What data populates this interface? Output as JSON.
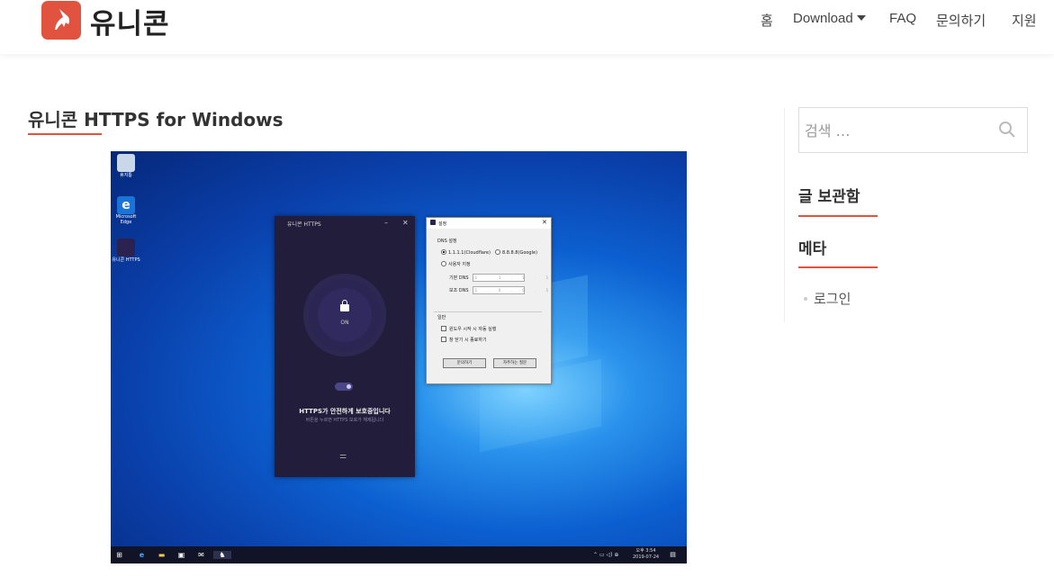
{
  "site": {
    "name": "유니콘",
    "brand_color": "#e2533f"
  },
  "nav": {
    "home": "홈",
    "download": "Download",
    "faq": "FAQ",
    "contact": "문의하기",
    "support": "지원"
  },
  "post": {
    "title": "유니콘 HTTPS for Windows"
  },
  "screenshot": {
    "desktop_icons": [
      "휴지통",
      "Microsoft Edge",
      "유니콘 HTTPS"
    ],
    "app": {
      "title": "유니콘 HTTPS",
      "state": "ON",
      "status": "HTTPS가 안전하게 보호중입니다",
      "substatus": "버튼을 누르면 HTTPS 보호가 해제됩니다"
    },
    "dialog": {
      "title": "설정",
      "dns_group": "DNS 설정",
      "opt1": "1.1.1.1(Cloudflare)",
      "opt2": "8.8.8.8(Google)",
      "opt3": "사용자 지정",
      "primary_label": "기본 DNS",
      "primary_value": "1 . 1 . 1 . 1",
      "secondary_label": "보조 DNS",
      "secondary_value": "1 . 0 . 0 . 1",
      "general_group": "일반",
      "chk1": "윈도우 시작 시 자동 실행",
      "chk2": "창 닫기 시 종료하기",
      "btn1": "문의하기",
      "btn2": "자주하는 질문"
    },
    "taskbar": {
      "time": "오후 3:54",
      "date": "2019-07-24"
    }
  },
  "sidebar": {
    "search_placeholder": "검색 …",
    "archive_title": "글 보관함",
    "meta_title": "메타",
    "meta_items": [
      "로그인"
    ]
  }
}
